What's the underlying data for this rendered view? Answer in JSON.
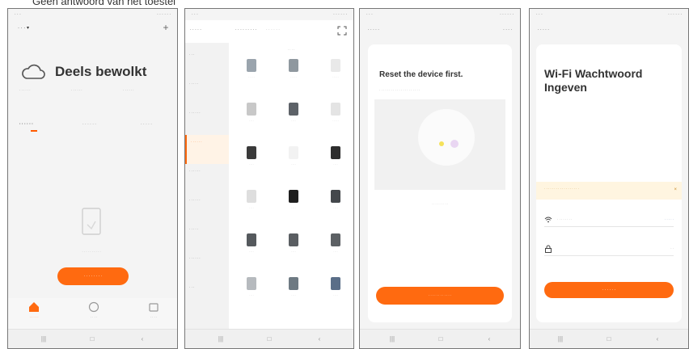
{
  "caption": {
    "text": "Geen antwoord van het toestel"
  },
  "status_bar": {
    "time": "· · ·",
    "system": "· · · · · ·"
  },
  "phone1": {
    "home_label": "· · · ▾",
    "add_label": "+",
    "weather": "Deels bewolkt",
    "stats": [
      "· · · · · ·",
      "· · · · · ·",
      "· · · · · ·"
    ],
    "tabs": [
      "· · · · · ·",
      "· · · · · ·",
      "· · · · ·"
    ],
    "empty_text": "· · · · · · · · · ·",
    "add_device_label": "· · · · · · · ·",
    "bottom_tabs": [
      "· · · · ·",
      "· · · ·",
      "· · · ·"
    ]
  },
  "phone2": {
    "back_label": "· · · · ·",
    "tab_manual": "· · · · · · · · ·",
    "tab_auto": "· · · · · ·",
    "categories": [
      "· · ·",
      "· · · · ·",
      "· · · · · ·",
      "· · · · · ·",
      "· · · · · ·",
      "· · · · · ·",
      "· · · · ·",
      "· · · · · ·",
      "· · ·"
    ],
    "section_title": "· · · ·",
    "devices": [
      "· · · · ·",
      "· · · · ·",
      "· · · · ·",
      "· · · ·",
      "· · · ·",
      "· · · · ·",
      "· · · ·",
      "· · · ·",
      "· · · ·",
      "· · · ·",
      "· · · ·",
      "· · · ·",
      "· · · ·",
      "· · · ·",
      "· · · ·",
      "· · · ·",
      "· · · ·",
      "· · · ·"
    ]
  },
  "phone3": {
    "back_label": "· · · · ·",
    "right_label": "· · · ·",
    "title": "Reset the device first.",
    "subtitle": "· · · · · · · · · · · · · · · · · · · · ·",
    "blink_text": "· · · · · · · · ·",
    "confirm_label": "· · · · · · · · · · · ·"
  },
  "phone4": {
    "back_label": "· · · · ·",
    "title": "Wi-Fi Wachtwoord Ingeven",
    "warning": "· · · · · · · · · · · · · · · · · ·",
    "wifi_value": "· · · · · · · ·",
    "change_label": "· · · · ·",
    "password_value": "· ·",
    "next_label": "· · · · · ·"
  }
}
